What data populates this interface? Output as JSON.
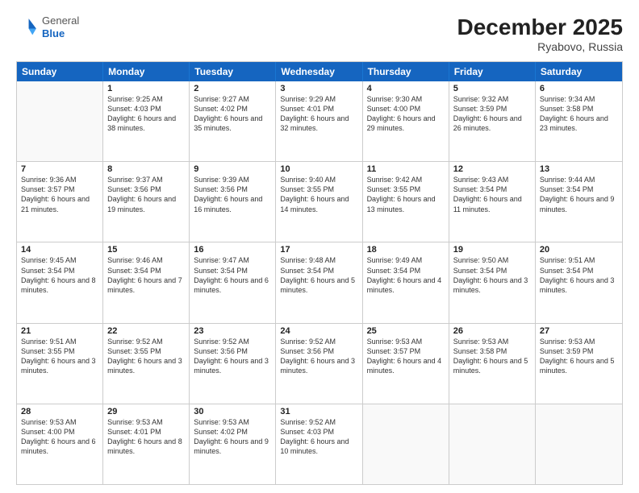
{
  "logo": {
    "general": "General",
    "blue": "Blue"
  },
  "title": "December 2025",
  "location": "Ryabovo, Russia",
  "days": [
    "Sunday",
    "Monday",
    "Tuesday",
    "Wednesday",
    "Thursday",
    "Friday",
    "Saturday"
  ],
  "rows": [
    [
      {
        "day": "",
        "empty": true
      },
      {
        "day": "1",
        "sunrise": "Sunrise: 9:25 AM",
        "sunset": "Sunset: 4:03 PM",
        "daylight": "Daylight: 6 hours and 38 minutes."
      },
      {
        "day": "2",
        "sunrise": "Sunrise: 9:27 AM",
        "sunset": "Sunset: 4:02 PM",
        "daylight": "Daylight: 6 hours and 35 minutes."
      },
      {
        "day": "3",
        "sunrise": "Sunrise: 9:29 AM",
        "sunset": "Sunset: 4:01 PM",
        "daylight": "Daylight: 6 hours and 32 minutes."
      },
      {
        "day": "4",
        "sunrise": "Sunrise: 9:30 AM",
        "sunset": "Sunset: 4:00 PM",
        "daylight": "Daylight: 6 hours and 29 minutes."
      },
      {
        "day": "5",
        "sunrise": "Sunrise: 9:32 AM",
        "sunset": "Sunset: 3:59 PM",
        "daylight": "Daylight: 6 hours and 26 minutes."
      },
      {
        "day": "6",
        "sunrise": "Sunrise: 9:34 AM",
        "sunset": "Sunset: 3:58 PM",
        "daylight": "Daylight: 6 hours and 23 minutes."
      }
    ],
    [
      {
        "day": "7",
        "sunrise": "Sunrise: 9:36 AM",
        "sunset": "Sunset: 3:57 PM",
        "daylight": "Daylight: 6 hours and 21 minutes."
      },
      {
        "day": "8",
        "sunrise": "Sunrise: 9:37 AM",
        "sunset": "Sunset: 3:56 PM",
        "daylight": "Daylight: 6 hours and 19 minutes."
      },
      {
        "day": "9",
        "sunrise": "Sunrise: 9:39 AM",
        "sunset": "Sunset: 3:56 PM",
        "daylight": "Daylight: 6 hours and 16 minutes."
      },
      {
        "day": "10",
        "sunrise": "Sunrise: 9:40 AM",
        "sunset": "Sunset: 3:55 PM",
        "daylight": "Daylight: 6 hours and 14 minutes."
      },
      {
        "day": "11",
        "sunrise": "Sunrise: 9:42 AM",
        "sunset": "Sunset: 3:55 PM",
        "daylight": "Daylight: 6 hours and 13 minutes."
      },
      {
        "day": "12",
        "sunrise": "Sunrise: 9:43 AM",
        "sunset": "Sunset: 3:54 PM",
        "daylight": "Daylight: 6 hours and 11 minutes."
      },
      {
        "day": "13",
        "sunrise": "Sunrise: 9:44 AM",
        "sunset": "Sunset: 3:54 PM",
        "daylight": "Daylight: 6 hours and 9 minutes."
      }
    ],
    [
      {
        "day": "14",
        "sunrise": "Sunrise: 9:45 AM",
        "sunset": "Sunset: 3:54 PM",
        "daylight": "Daylight: 6 hours and 8 minutes."
      },
      {
        "day": "15",
        "sunrise": "Sunrise: 9:46 AM",
        "sunset": "Sunset: 3:54 PM",
        "daylight": "Daylight: 6 hours and 7 minutes."
      },
      {
        "day": "16",
        "sunrise": "Sunrise: 9:47 AM",
        "sunset": "Sunset: 3:54 PM",
        "daylight": "Daylight: 6 hours and 6 minutes."
      },
      {
        "day": "17",
        "sunrise": "Sunrise: 9:48 AM",
        "sunset": "Sunset: 3:54 PM",
        "daylight": "Daylight: 6 hours and 5 minutes."
      },
      {
        "day": "18",
        "sunrise": "Sunrise: 9:49 AM",
        "sunset": "Sunset: 3:54 PM",
        "daylight": "Daylight: 6 hours and 4 minutes."
      },
      {
        "day": "19",
        "sunrise": "Sunrise: 9:50 AM",
        "sunset": "Sunset: 3:54 PM",
        "daylight": "Daylight: 6 hours and 3 minutes."
      },
      {
        "day": "20",
        "sunrise": "Sunrise: 9:51 AM",
        "sunset": "Sunset: 3:54 PM",
        "daylight": "Daylight: 6 hours and 3 minutes."
      }
    ],
    [
      {
        "day": "21",
        "sunrise": "Sunrise: 9:51 AM",
        "sunset": "Sunset: 3:55 PM",
        "daylight": "Daylight: 6 hours and 3 minutes."
      },
      {
        "day": "22",
        "sunrise": "Sunrise: 9:52 AM",
        "sunset": "Sunset: 3:55 PM",
        "daylight": "Daylight: 6 hours and 3 minutes."
      },
      {
        "day": "23",
        "sunrise": "Sunrise: 9:52 AM",
        "sunset": "Sunset: 3:56 PM",
        "daylight": "Daylight: 6 hours and 3 minutes."
      },
      {
        "day": "24",
        "sunrise": "Sunrise: 9:52 AM",
        "sunset": "Sunset: 3:56 PM",
        "daylight": "Daylight: 6 hours and 3 minutes."
      },
      {
        "day": "25",
        "sunrise": "Sunrise: 9:53 AM",
        "sunset": "Sunset: 3:57 PM",
        "daylight": "Daylight: 6 hours and 4 minutes."
      },
      {
        "day": "26",
        "sunrise": "Sunrise: 9:53 AM",
        "sunset": "Sunset: 3:58 PM",
        "daylight": "Daylight: 6 hours and 5 minutes."
      },
      {
        "day": "27",
        "sunrise": "Sunrise: 9:53 AM",
        "sunset": "Sunset: 3:59 PM",
        "daylight": "Daylight: 6 hours and 5 minutes."
      }
    ],
    [
      {
        "day": "28",
        "sunrise": "Sunrise: 9:53 AM",
        "sunset": "Sunset: 4:00 PM",
        "daylight": "Daylight: 6 hours and 6 minutes."
      },
      {
        "day": "29",
        "sunrise": "Sunrise: 9:53 AM",
        "sunset": "Sunset: 4:01 PM",
        "daylight": "Daylight: 6 hours and 8 minutes."
      },
      {
        "day": "30",
        "sunrise": "Sunrise: 9:53 AM",
        "sunset": "Sunset: 4:02 PM",
        "daylight": "Daylight: 6 hours and 9 minutes."
      },
      {
        "day": "31",
        "sunrise": "Sunrise: 9:52 AM",
        "sunset": "Sunset: 4:03 PM",
        "daylight": "Daylight: 6 hours and 10 minutes."
      },
      {
        "day": "",
        "empty": true
      },
      {
        "day": "",
        "empty": true
      },
      {
        "day": "",
        "empty": true
      }
    ]
  ]
}
